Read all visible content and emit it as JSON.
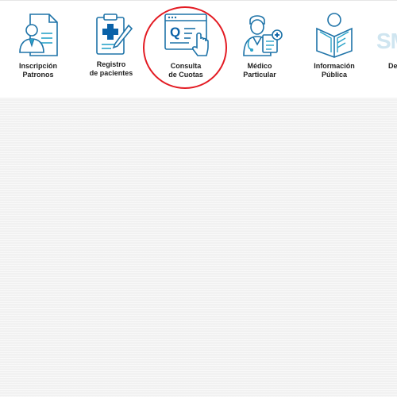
{
  "nav": {
    "items": [
      {
        "line1": "Inscripción",
        "line2": "Patronos",
        "icon": "employer-badge-icon"
      },
      {
        "line1": "Registro",
        "line2": "de pacientes",
        "icon": "medical-clipboard-icon"
      },
      {
        "line1": "Consulta",
        "line2": "de Cuotas",
        "icon": "search-fees-window-icon"
      },
      {
        "line1": "Médico",
        "line2": "Particular",
        "icon": "doctor-icon"
      },
      {
        "line1": "Información",
        "line2": "Pública",
        "icon": "public-info-book-icon"
      },
      {
        "line1": "De",
        "line2": "",
        "icon": "sm-logo-icon"
      }
    ],
    "partial_logo_text": "SM"
  },
  "colors": {
    "icon_blue": "#1e73a8",
    "icon_teal": "#2aa3c9",
    "highlight_red": "#e31b23",
    "accent_blue": "#0a62a8"
  }
}
